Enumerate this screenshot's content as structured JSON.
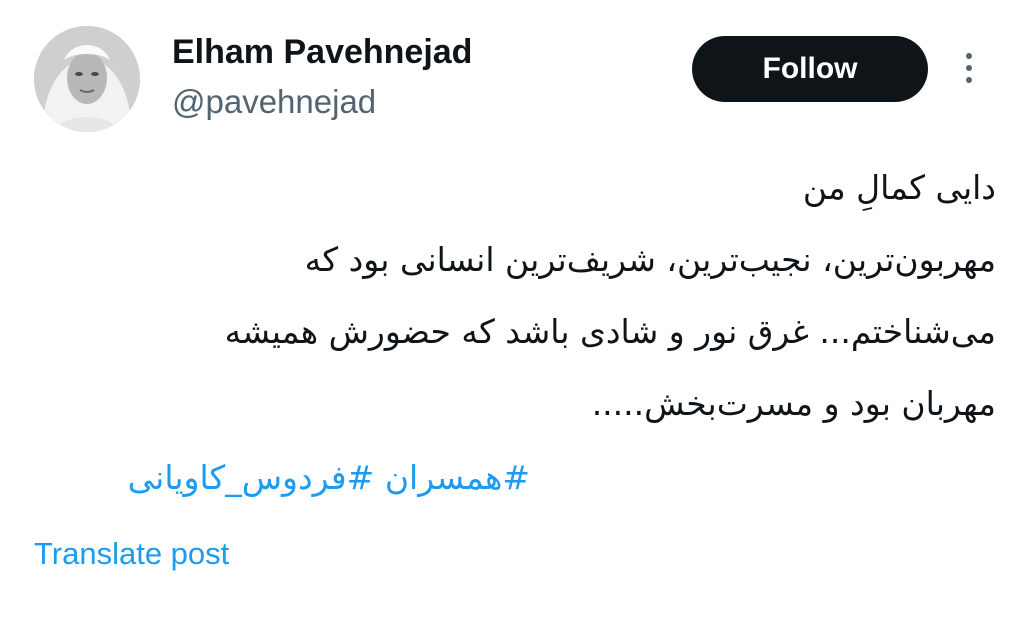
{
  "author": {
    "display_name": "Elham Pavehnejad",
    "handle": "@pavehnejad"
  },
  "actions": {
    "follow_label": "Follow",
    "more_icon": "more-vertical-icon"
  },
  "tweet": {
    "lines": [
      "دایی کمالِ من",
      "مهربون‌ترین، نجیب‌ترین، شریف‌ترین انسانی بود که",
      "می‌شناختم... غرق نور و شادی باشد که حضورش همیشه",
      "مهربان بود و مسرت‌بخش....."
    ],
    "hashtags": [
      "#همسران",
      "#فردوس_کاویانی"
    ]
  },
  "translate_label": "Translate post",
  "colors": {
    "link": "#1d9bf0",
    "text": "#0f1419",
    "secondary": "#536471",
    "button_bg": "#0f1419"
  }
}
